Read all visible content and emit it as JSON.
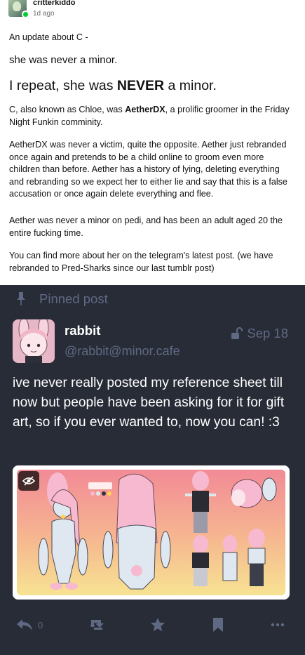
{
  "post": {
    "author": "critterkiddo",
    "time": "1d ago",
    "p1": "An update about C -",
    "p2": "she was never a minor.",
    "p3_before": "I repeat, she was ",
    "p3_bold": "NEVER",
    "p3_after": " a minor.",
    "p4_before": "C, also known as Chloe, was ",
    "p4_bold": "AetherDX",
    "p4_after": ", a prolific groomer in the Friday Night Funkin comminity.",
    "p5": "AetherDX was never a victim, quite the opposite. Aether just rebranded once again and pretends to be a child online to groom even more children than before. Aether has a history of lying, deleting everything and rebranding so we expect her to either lie and say that this is a false accusation or once again delete everything and flee.",
    "p6": "Aether was never a minor on pedi, and has been an adult aged 20 the entire fucking time.",
    "p7": "You can find more about her on the telegram's latest post. (we have rebranded to Pred-Sharks since our last tumblr post)"
  },
  "embed": {
    "pinned_label": "Pinned post",
    "display_name": "rabbit",
    "handle": "@rabbit@minor.cafe",
    "date": "Sep 18",
    "text": "ive never really posted my reference sheet till now but people have been asking for it for gift art, so if you ever wanted to, now you can! :3",
    "media_label": "COLORS",
    "reply_count": "0"
  },
  "colors": {
    "embed_bg": "#282c37",
    "muted": "#606984",
    "badge": "#00cf35"
  }
}
